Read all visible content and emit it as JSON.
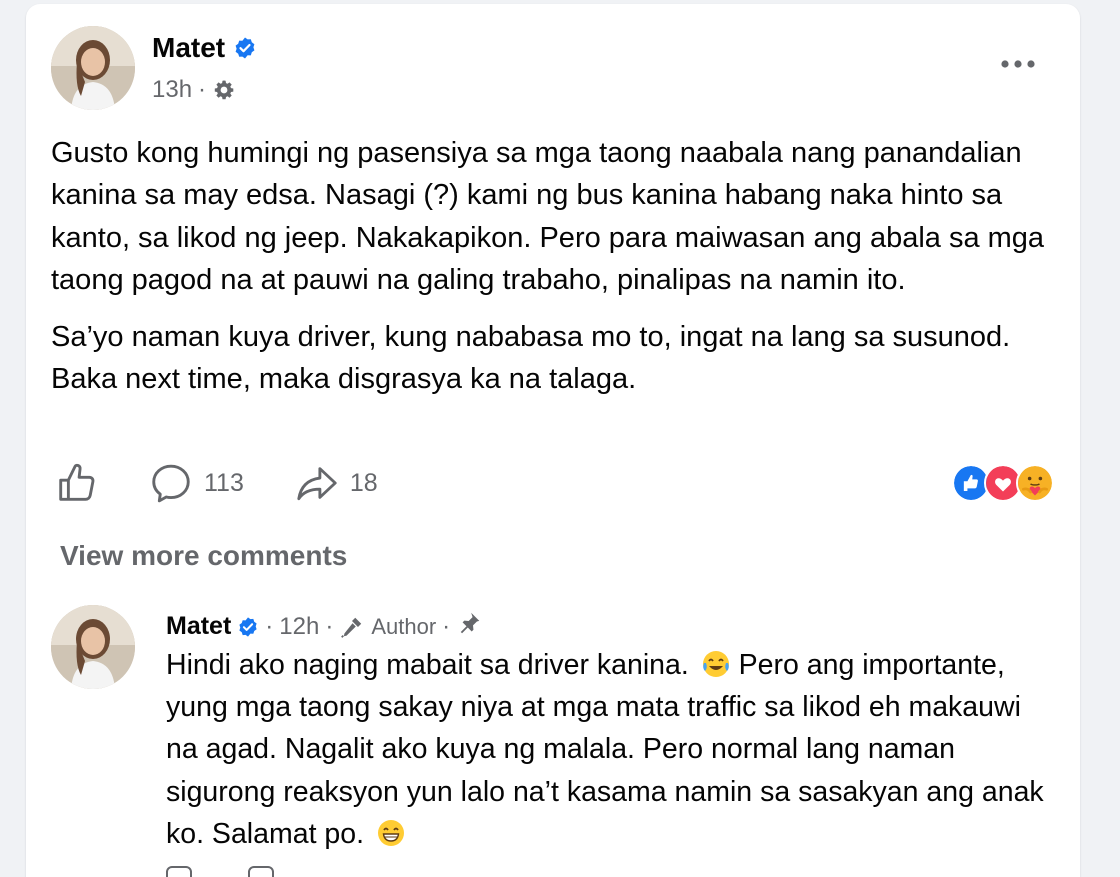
{
  "post": {
    "author": "Matet",
    "time": "13h",
    "separator": "·",
    "privacy_icon": "gear-icon",
    "body": [
      "Gusto kong humingi ng pasensiya sa mga taong naabala nang panandalian kanina sa may edsa. Nasagi (?) kami ng bus kanina habang naka hinto sa kanto, sa likod ng jeep. Nakakapikon. Pero para maiwasan ang abala sa mga taong pagod na at pauwi na galing trabaho, pinalipas na namin ito.",
      "Sa’yo naman kuya driver, kung nababasa mo to, ingat na lang sa susunod. Baka next time, maka disgrasya ka na talaga."
    ],
    "comments_count": "113",
    "shares_count": "18",
    "reactions": [
      "like",
      "love",
      "care"
    ]
  },
  "view_more_label": "View more comments",
  "comment": {
    "author": "Matet",
    "time": "12h",
    "author_badge": "Author",
    "text_parts": [
      "Hindi ako naging mabait sa driver kanina.",
      " Pero ang importante, yung mga taong sakay niya at mga mata traffic sa likod eh makauwi na agad. Nagalit ako kuya ng malala. Pero normal lang naman sigurong reaksyon yun lalo na’t kasama namin sa sasakyan ang anak ko. Salamat po."
    ]
  },
  "colors": {
    "verified": "#1877f2",
    "secondary_text": "#65676b",
    "like_blue": "#1877f2",
    "love_red": "#f33e58",
    "care_yellow": "#f7b125"
  }
}
